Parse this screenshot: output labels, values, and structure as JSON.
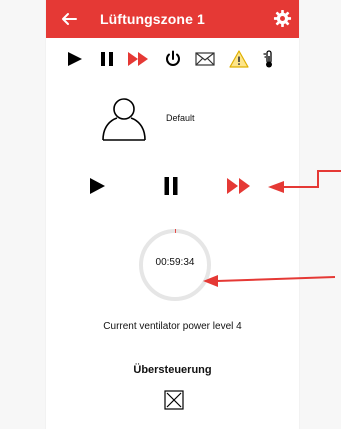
{
  "header": {
    "back_icon": "arrow-left-icon",
    "title": "Lüftungszone 1",
    "settings_icon": "gear-icon"
  },
  "toolbar": {
    "icons": [
      "play-icon",
      "pause-icon",
      "fast-forward-icon",
      "power-icon",
      "mail-icon",
      "warning-icon",
      "thermometer-icon"
    ]
  },
  "profile": {
    "icon": "user-icon",
    "label": "Default"
  },
  "controls": {
    "icons": [
      "play-icon",
      "pause-icon",
      "fast-forward-icon"
    ]
  },
  "timer": {
    "value": "00:59:34"
  },
  "status": {
    "power_text": "Current ventilator power level 4"
  },
  "override": {
    "title": "Übersteuerung",
    "icon": "close-box-icon"
  },
  "colors": {
    "accent": "#e53935",
    "warning": "#f2c200",
    "text": "#111111",
    "ring": "#e6e6e6"
  }
}
